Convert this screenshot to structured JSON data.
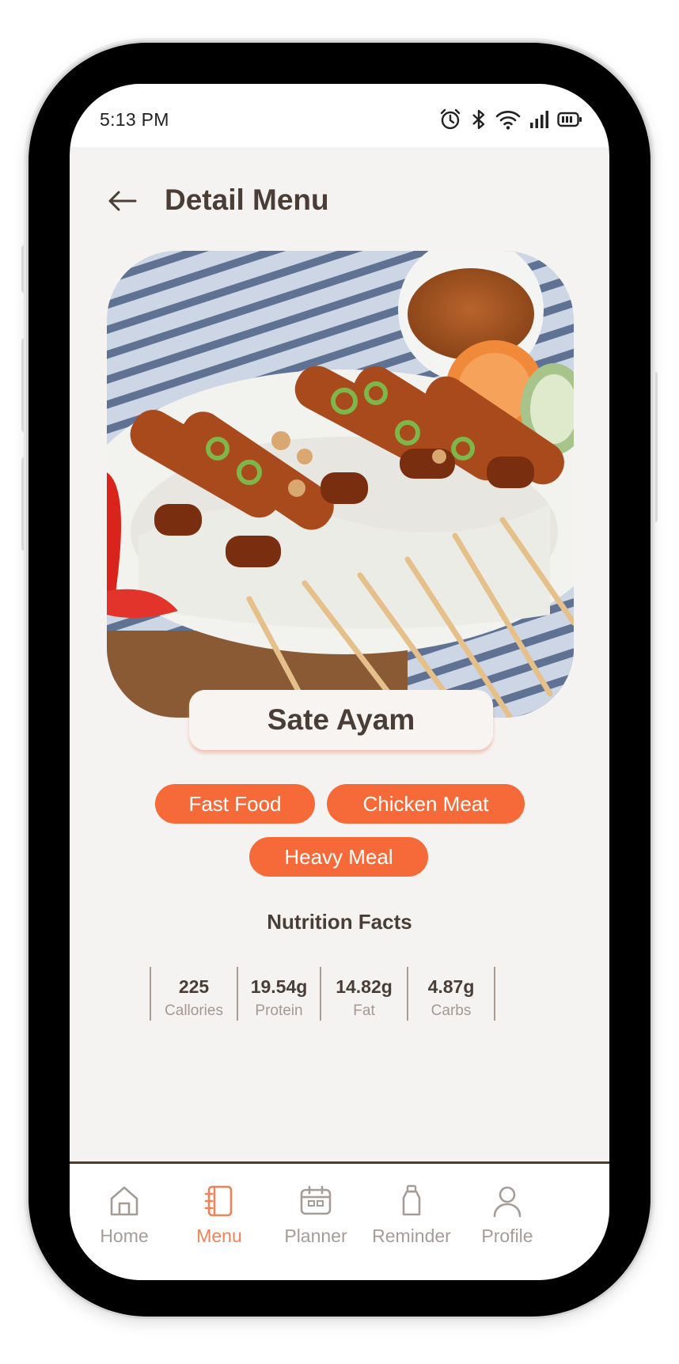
{
  "status_bar": {
    "time": "5:13 PM",
    "icons": [
      "alarm-icon",
      "bluetooth-icon",
      "wifi-icon",
      "signal-icon",
      "battery-icon"
    ]
  },
  "header": {
    "back_icon": "arrow-left-icon",
    "title": "Detail Menu"
  },
  "food": {
    "name": "Sate Ayam",
    "tags": [
      "Fast Food",
      "Chicken Meat",
      "Heavy Meal"
    ]
  },
  "nutrition": {
    "title": "Nutrition Facts",
    "items": [
      {
        "value": "225",
        "label": "Callories"
      },
      {
        "value": "19.54g",
        "label": "Protein"
      },
      {
        "value": "14.82g",
        "label": "Fat"
      },
      {
        "value": "4.87g",
        "label": "Carbs"
      }
    ]
  },
  "nav": {
    "active": "Menu",
    "items": [
      {
        "label": "Home",
        "icon": "home-icon"
      },
      {
        "label": "Menu",
        "icon": "menu-book-icon"
      },
      {
        "label": "Planner",
        "icon": "calendar-icon"
      },
      {
        "label": "Reminder",
        "icon": "bottle-icon"
      },
      {
        "label": "Profile",
        "icon": "user-icon"
      }
    ]
  },
  "colors": {
    "accent": "#f56a38",
    "nav_active": "#f0825a",
    "text_dark": "#4a3d35",
    "text_muted": "#a59892",
    "background": "#f5f3f2"
  }
}
